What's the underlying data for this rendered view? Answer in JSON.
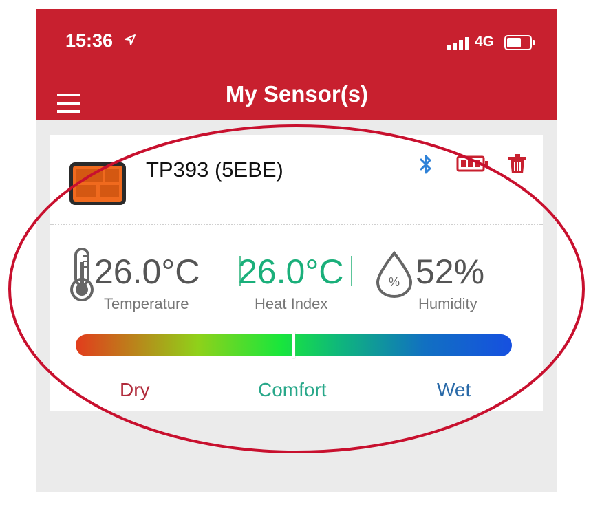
{
  "status_bar": {
    "time": "15:36",
    "network": "4G",
    "location_icon": "location-arrow-icon",
    "signal_icon": "signal-icon",
    "battery_icon": "battery-icon"
  },
  "nav": {
    "title": "My Sensor(s)",
    "menu_icon": "hamburger-menu-icon"
  },
  "sensor": {
    "name": "TP393 (5EBE)",
    "icons": [
      "device-thumbnail-icon",
      "bluetooth-icon",
      "battery-icon",
      "trash-icon"
    ],
    "temperature": {
      "value": "26.0°C",
      "label": "Temperature"
    },
    "heat_index": {
      "value": "26.0°C",
      "label": "Heat Index"
    },
    "humidity": {
      "value": "52%",
      "label": "Humidity"
    },
    "comfort_scale": {
      "labels": [
        "Dry",
        "Comfort",
        "Wet"
      ],
      "marker_fraction": 0.5
    }
  },
  "colors": {
    "brand_red": "#c8202f",
    "heat_index_green": "#1aaf7a",
    "dry_label": "#b02a3a",
    "comfort_label": "#29a88a",
    "wet_label": "#2a6aa8",
    "annotation_ellipse": "#c8102e"
  }
}
